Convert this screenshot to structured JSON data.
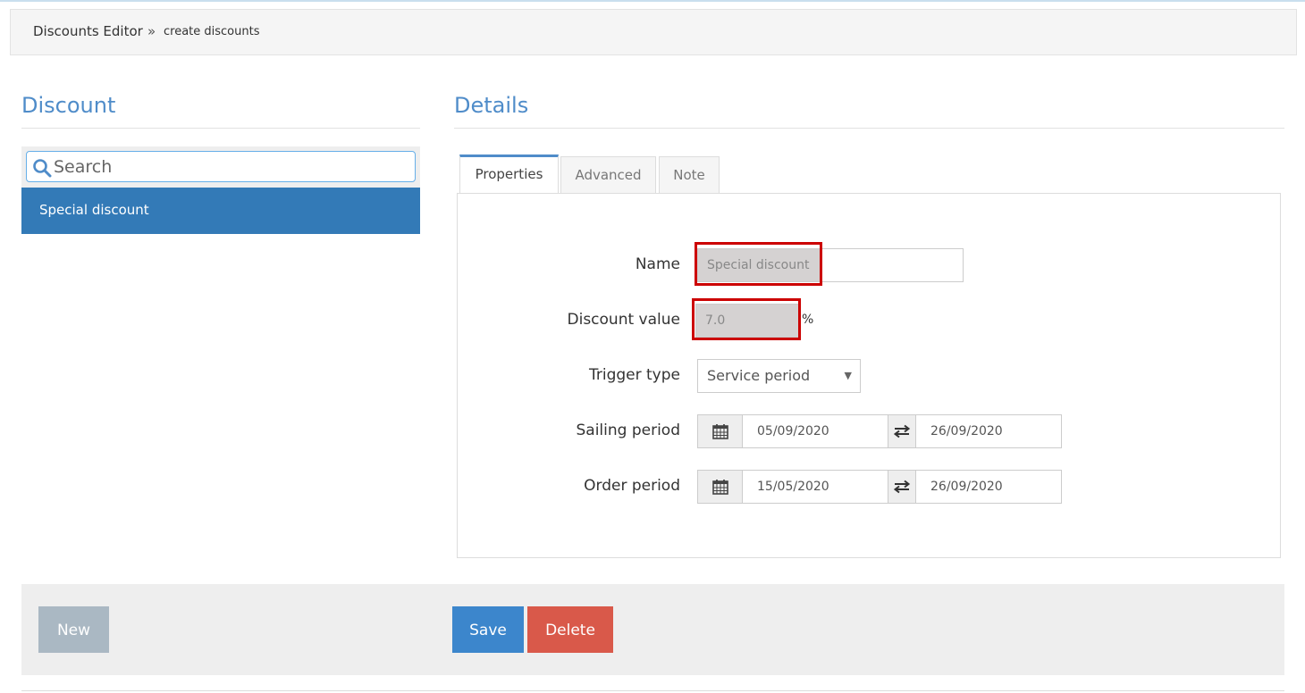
{
  "breadcrumb": {
    "main": "Discounts Editor",
    "separator": "»",
    "sub": "create discounts"
  },
  "left": {
    "title": "Discount",
    "search_placeholder": "Search",
    "items": [
      {
        "label": "Special discount",
        "selected": true
      }
    ]
  },
  "right": {
    "title": "Details",
    "tabs": [
      {
        "label": "Properties",
        "active": true
      },
      {
        "label": "Advanced",
        "active": false
      },
      {
        "label": "Note",
        "active": false
      }
    ],
    "form": {
      "name_label": "Name",
      "name_value": "Special discount",
      "discount_label": "Discount value",
      "discount_value": "7.0",
      "discount_unit": "%",
      "trigger_label": "Trigger type",
      "trigger_value": "Service period",
      "sailing_label": "Sailing period",
      "sailing_from": "05/09/2020",
      "sailing_to": "26/09/2020",
      "order_label": "Order period",
      "order_from": "15/05/2020",
      "order_to": "26/09/2020"
    }
  },
  "footer": {
    "new_label": "New",
    "save_label": "Save",
    "delete_label": "Delete"
  },
  "colors": {
    "accent": "#4f8cc9",
    "selected_bg": "#337ab7",
    "save": "#3c86cc",
    "delete": "#d9594a",
    "highlight": "#cc0000"
  },
  "icons": {
    "search": "search-icon",
    "calendar": "calendar-icon",
    "swap": "swap-arrows-icon",
    "dropdown": "caret-down-icon"
  }
}
